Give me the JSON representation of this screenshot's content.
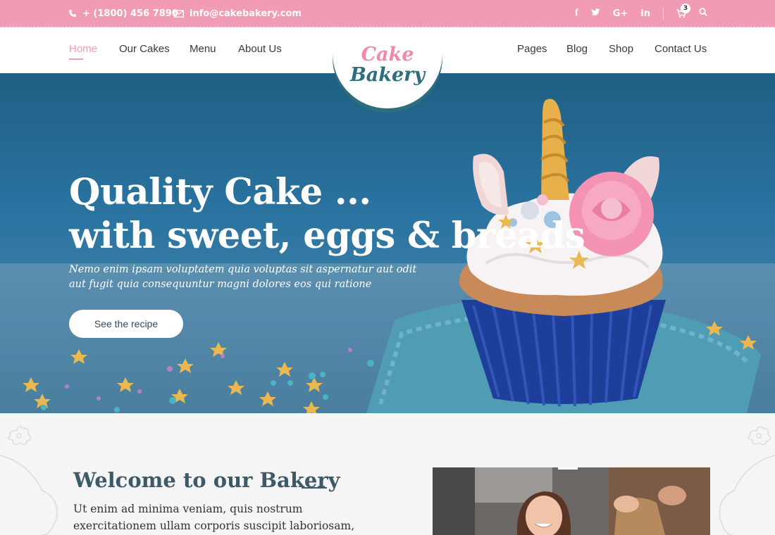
{
  "topbar": {
    "phone": "+ (1800) 456 7890",
    "email": "info@cakebakery.com",
    "socials": [
      "f",
      "facebook-icon",
      "twitter-icon",
      "google-plus-icon",
      "linkedin-icon"
    ],
    "cart_count": "3"
  },
  "nav": {
    "left": [
      "Home",
      "Our Cakes",
      "Menu",
      "About Us"
    ],
    "right": [
      "Pages",
      "Blog",
      "Shop",
      "Contact Us"
    ],
    "active": "Home"
  },
  "logo": {
    "line1": "Cake",
    "line2": "Bakery"
  },
  "hero": {
    "title_line1": "Quality Cake ...",
    "title_line2": "with sweet, eggs & breads",
    "subtitle": "Nemo enim ipsam voluptatem quia voluptas sit aspernatur aut odit aut fugit quia consequuntur magni dolores eos qui ratione",
    "button": "See the recipe"
  },
  "welcome": {
    "heading": "Welcome to our Bakery",
    "body": "Ut enim ad minima veniam, quis nostrum exercitationem ullam corporis suscipit laboriosam, nisi ut aliquid ex ea"
  },
  "colors": {
    "pink": "#f29bb5",
    "teal": "#2d6e7e",
    "heading": "#3e5968"
  }
}
